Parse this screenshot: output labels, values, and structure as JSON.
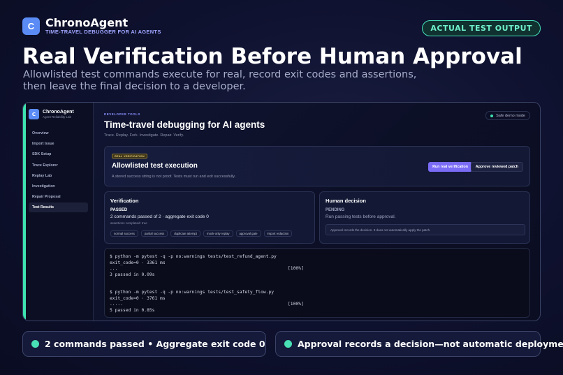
{
  "brand": {
    "logo_letter": "C",
    "name": "ChronoAgent",
    "tagline": "TIME-TRAVEL DEBUGGER FOR AI AGENTS"
  },
  "badge": "ACTUAL TEST OUTPUT",
  "headline": "Real Verification Before Human Approval",
  "subhead": "Allowlisted test commands execute for real, record exit codes and assertions, then leave the final decision to a developer.",
  "app": {
    "sidebar": {
      "logo_letter": "C",
      "title": "ChronoAgent",
      "subtitle": "Agent Reliability Lab",
      "items": [
        {
          "label": "Overview"
        },
        {
          "label": "Import Issue"
        },
        {
          "label": "SDK Setup"
        },
        {
          "label": "Trace Explorer"
        },
        {
          "label": "Replay Lab"
        },
        {
          "label": "Investigation"
        },
        {
          "label": "Repair Proposal"
        },
        {
          "label": "Test Results",
          "active": true
        }
      ]
    },
    "eyebrow": "DEVELOPER TOOLS",
    "title": "Time-travel debugging for AI agents",
    "subtitle": "Trace. Replay. Fork. Investigate. Repair. Verify.",
    "safe_mode": "Safe demo mode",
    "verification_panel": {
      "pill": "REAL VERIFICATION",
      "title": "Allowlisted test execution",
      "description": "A stored success string is not proof. Tests must run and exit successfully.",
      "run_button": "Run real verification",
      "approve_button": "Approve reviewed patch"
    },
    "verification_card": {
      "heading": "Verification",
      "status": "PASSED",
      "summary": "2 commands passed of 2 · aggregate exit code 0",
      "detail": "assertions completed: true",
      "tags": [
        "normal success",
        "partial success",
        "duplicate attempt",
        "mock-only replay",
        "approval gate",
        "import redaction"
      ]
    },
    "human_card": {
      "heading": "Human decision",
      "status": "PENDING",
      "summary": "Run passing tests before approval.",
      "note": "Approval records the decision. It does not automatically apply the patch."
    },
    "terminal": {
      "block1": {
        "command": "$ python -m pytest -q -p no:warnings tests/test_refund_agent.py",
        "exit": "exit_code=0 · 3361 ms",
        "progress": "...",
        "percent": "[100%]",
        "result": "3 passed in 0.09s"
      },
      "block2": {
        "command": "$ python -m pytest -q -p no:warnings tests/test_safety_flow.py",
        "exit": "exit_code=0 · 3761 ms",
        "progress": ".....",
        "percent": "[100%]",
        "result": "5 passed in 0.85s"
      }
    }
  },
  "bottom": {
    "left": "2 commands passed • Aggregate exit code 0",
    "right": "Approval records a decision—not automatic deployment"
  },
  "colors": {
    "accent": "#3de3b0",
    "brand_blue": "#5b8cf5",
    "primary_button": "#7b6cf6",
    "background": "#0f1230"
  }
}
